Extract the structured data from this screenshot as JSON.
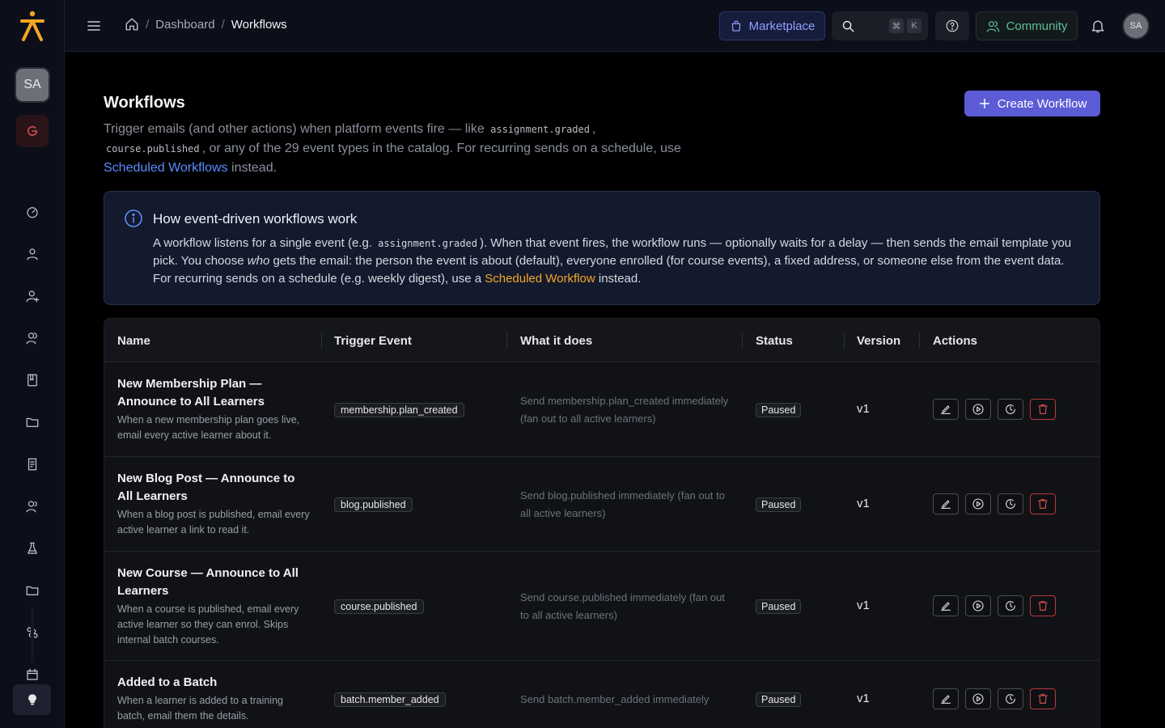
{
  "sidebar": {
    "user_initials": "SA",
    "nav_icons": [
      "dashboard-icon",
      "user-icon",
      "user-plus-icon",
      "users-icon",
      "book-icon",
      "folder-icon",
      "document-icon",
      "user-group-icon",
      "flask-icon",
      "folder-alt-icon",
      "workflow-icon",
      "calendar-icon"
    ],
    "bottom_icon": "lightbulb-icon"
  },
  "topbar": {
    "breadcrumbs": [
      "Dashboard",
      "Workflows"
    ],
    "marketplace_label": "Marketplace",
    "shortcut_keys": [
      "⌘",
      "K"
    ],
    "community_label": "Community",
    "avatar_initials": "SA"
  },
  "page": {
    "title": "Workflows",
    "create_label": "Create Workflow",
    "intro_1": "Trigger emails (and other actions) when platform events fire — like ",
    "intro_code_1": "assignment.graded",
    "intro_2": ",",
    "intro_code_2": "course.published",
    "intro_3": ", or any of the 29 event types in the catalog. For recurring sends on a schedule, use ",
    "intro_link": "Scheduled Workflows",
    "intro_4": " instead."
  },
  "info": {
    "title": "How event-driven workflows work",
    "body_1": "A workflow listens for a single event (e.g. ",
    "body_code": "assignment.graded",
    "body_2": "). When that event fires, the workflow runs — optionally waits for a delay — then sends the email template you pick. You choose ",
    "body_em": "who",
    "body_3": " gets the email: the person the event is about (default), everyone enrolled (for course events), a fixed address, or someone else from the event data. For recurring sends on a schedule (e.g. weekly digest), use a ",
    "body_link": "Scheduled Workflow",
    "body_4": " instead."
  },
  "table": {
    "headers": [
      "Name",
      "Trigger Event",
      "What it does",
      "Status",
      "Version",
      "Actions"
    ],
    "rows": [
      {
        "name": "New Membership Plan — Announce to All Learners",
        "description": "When a new membership plan goes live, email every active learner about it.",
        "event": "membership.plan_created",
        "does": "Send membership.plan_created immediately (fan out to all active learners)",
        "status": "Paused",
        "version": "v1"
      },
      {
        "name": "New Blog Post — Announce to All Learners",
        "description": "When a blog post is published, email every active learner a link to read it.",
        "event": "blog.published",
        "does": "Send blog.published immediately (fan out to all active learners)",
        "status": "Paused",
        "version": "v1"
      },
      {
        "name": "New Course — Announce to All Learners",
        "description": "When a course is published, email every active learner so they can enrol. Skips internal batch courses.",
        "event": "course.published",
        "does": "Send course.published immediately (fan out to all active learners)",
        "status": "Paused",
        "version": "v1"
      },
      {
        "name": "Added to a Batch",
        "description": "When a learner is added to a training batch, email them the details.",
        "event": "batch.member_added",
        "does": "Send batch.member_added immediately",
        "status": "Paused",
        "version": "v1"
      }
    ],
    "action_icons": [
      "edit-icon",
      "run-icon",
      "history-icon",
      "delete-icon"
    ]
  },
  "colors": {
    "accent": "#5b5cd6",
    "link_blue": "#5b8cff",
    "link_orange": "#f5a623",
    "danger": "#e0524f",
    "logo": "#f5a623"
  }
}
